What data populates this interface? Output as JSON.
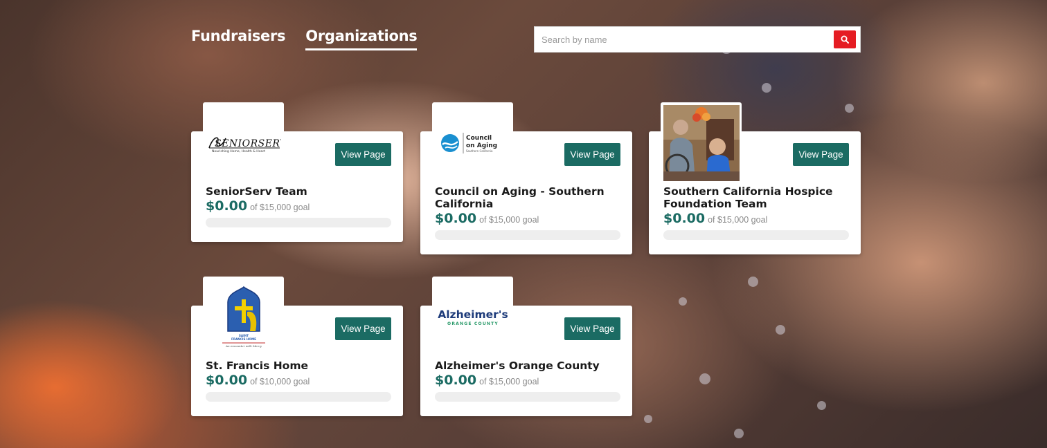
{
  "nav": {
    "tabs": [
      {
        "label": "Fundraisers",
        "active": false
      },
      {
        "label": "Organizations",
        "active": true
      }
    ]
  },
  "search": {
    "placeholder": "Search by name",
    "value": "",
    "button_icon": "search-icon",
    "button_color": "#e51c23"
  },
  "theme": {
    "accent": "#1b6b63"
  },
  "cards": [
    {
      "name": "SeniorServ Team",
      "amount": "$0.00",
      "goal": "of $15,000 goal",
      "progress_fraction": 0,
      "button_label": "View Page",
      "logo": {
        "kind": "seniorserv",
        "wordmark": "SENIORSERV",
        "tagline": "Nourishing Home, Health & Heart"
      }
    },
    {
      "name": "Council on Aging - Southern California",
      "amount": "$0.00",
      "goal": "of $15,000 goal",
      "progress_fraction": 0,
      "button_label": "View Page",
      "logo": {
        "kind": "council",
        "line1": "Council",
        "line2": "on Aging",
        "line3": "Southern California"
      }
    },
    {
      "name": "Southern California Hospice Foundation Team",
      "amount": "$0.00",
      "goal": "of $15,000 goal",
      "progress_fraction": 0,
      "button_label": "View Page",
      "logo": {
        "kind": "photo"
      }
    },
    {
      "name": "St. Francis Home",
      "amount": "$0.00",
      "goal": "of $10,000 goal",
      "progress_fraction": 0,
      "button_label": "View Page",
      "logo": {
        "kind": "stfrancis",
        "line1": "SAINT",
        "line2": "FRANCIS HOME",
        "tagline": "An encounter with Mercy"
      }
    },
    {
      "name": "Alzheimer's Orange County",
      "amount": "$0.00",
      "goal": "of $15,000 goal",
      "progress_fraction": 0,
      "button_label": "View Page",
      "logo": {
        "kind": "alz",
        "line1": "Alzheimer's",
        "line2": "ORANGE COUNTY"
      }
    }
  ]
}
